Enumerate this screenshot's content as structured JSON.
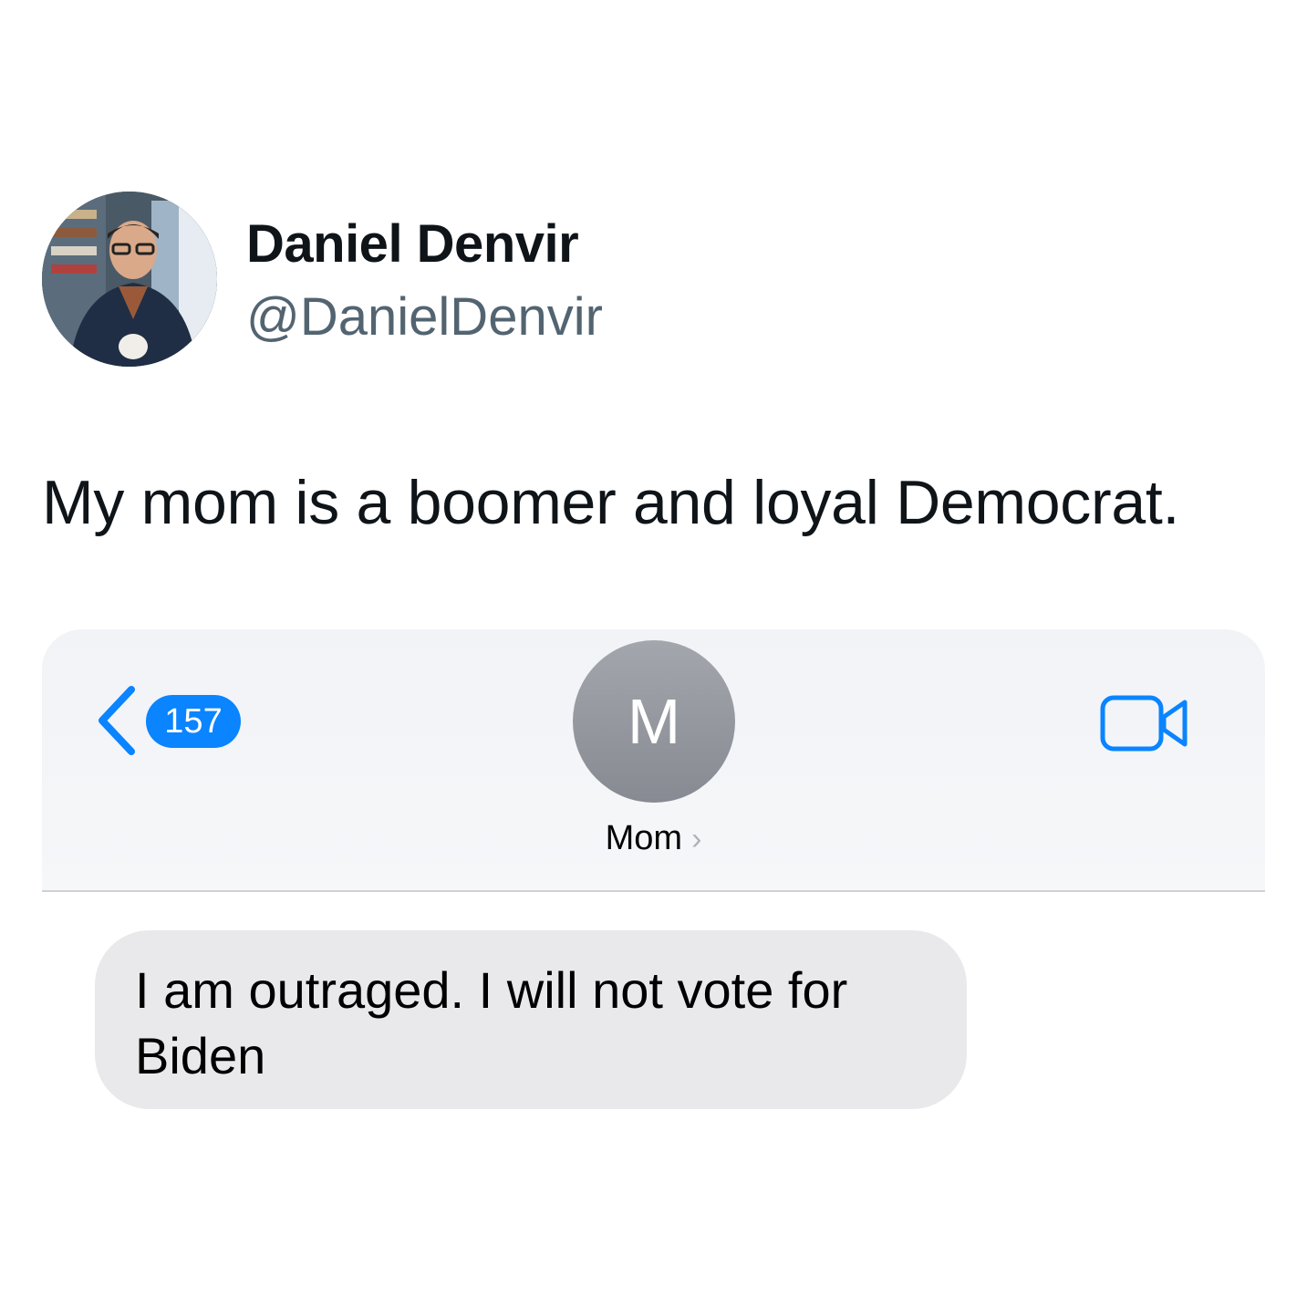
{
  "tweet": {
    "display_name": "Daniel Denvir",
    "handle": "@DanielDenvir",
    "text": "My mom is a boomer and loyal Democrat.",
    "avatar_icon": "profile-photo"
  },
  "messages_screenshot": {
    "back_badge_count": "157",
    "contact_initial": "M",
    "contact_name": "Mom",
    "contact_chevron": "›",
    "video_icon": "video-camera-icon",
    "accent_color": "#0a84ff",
    "message": {
      "line1": "I am outraged. I will not vote for",
      "line2": "Biden"
    }
  }
}
